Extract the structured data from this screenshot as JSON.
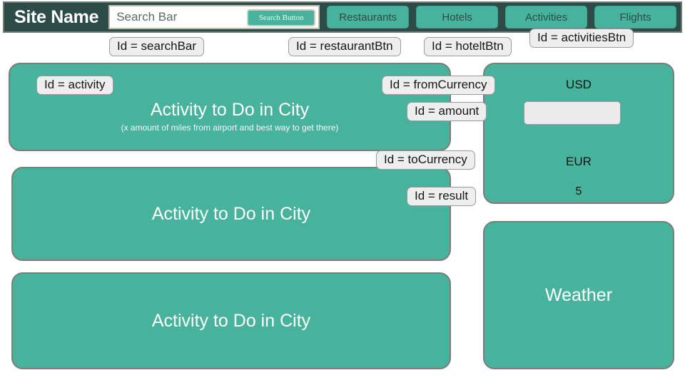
{
  "header": {
    "site_title": "Site Name",
    "search": {
      "placeholder": "Search Bar",
      "value": "",
      "button_label": "Search Button"
    },
    "nav": [
      {
        "label": "Restaurants"
      },
      {
        "label": "Hotels"
      },
      {
        "label": "Activities"
      },
      {
        "label": "Flights"
      }
    ]
  },
  "cards": {
    "activity_1": {
      "title": "Activity to Do in City",
      "subtitle": "(x amount of miles from airport and best way to get there)"
    },
    "activity_2": {
      "title": "Activity to Do in City"
    },
    "activity_3": {
      "title": "Activity to Do in City"
    },
    "weather": {
      "title": "Weather"
    }
  },
  "currency": {
    "from_currency": "USD",
    "amount_value": "",
    "amount_placeholder": "",
    "to_currency": "EUR",
    "result": "5"
  },
  "annotations": {
    "search_bar": "Id = searchBar",
    "restaurant_btn": "Id = restaurantBtn",
    "hotel_btn": "Id = hoteltBtn",
    "activities_btn": "Id = activitiesBtn",
    "activity": "Id = activity",
    "from_currency": "Id = fromCurrency",
    "amount": "Id = amount",
    "to_currency": "Id = toCurrency",
    "result": "Id = result"
  },
  "colors": {
    "header_bg": "#2d4c48",
    "accent_teal": "#47b39c",
    "card_border": "#7d7d78",
    "annotation_bg": "#eeeeee",
    "page_bg": "#ffffff"
  }
}
